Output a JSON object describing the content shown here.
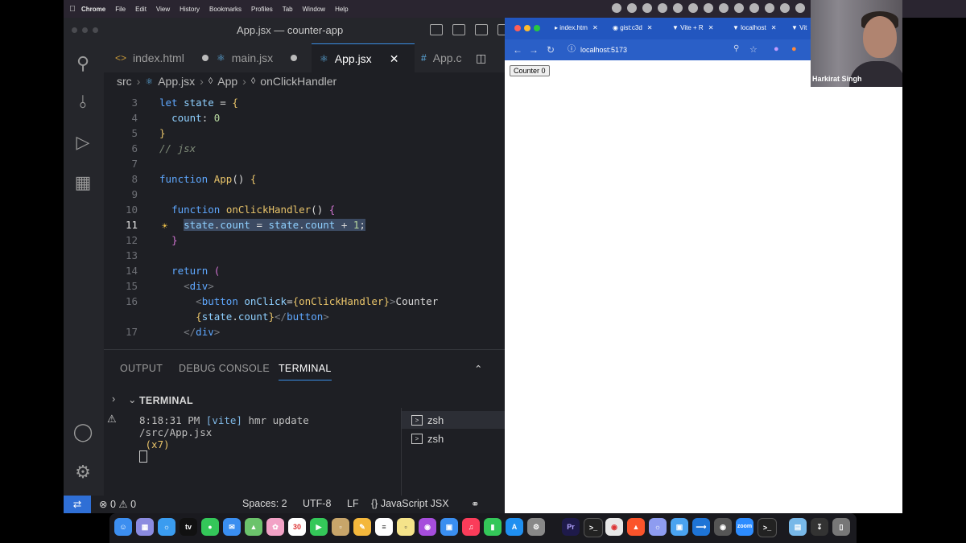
{
  "menubar": {
    "app": "Chrome",
    "items": [
      "File",
      "Edit",
      "View",
      "History",
      "Bookmarks",
      "Profiles",
      "Tab",
      "Window",
      "Help"
    ]
  },
  "vscode": {
    "window_title": "App.jsx — counter-app",
    "tabs": [
      {
        "label": "index.html",
        "modified": true
      },
      {
        "label": "main.jsx",
        "modified": true
      },
      {
        "label": "App.jsx",
        "active": true
      },
      {
        "label": "App.c"
      }
    ],
    "breadcrumb": [
      "src",
      "App.jsx",
      "App",
      "onClickHandler"
    ],
    "code_lines": [
      {
        "n": "3",
        "text": "let state = {"
      },
      {
        "n": "4",
        "text": "  count: 0"
      },
      {
        "n": "5",
        "text": "}"
      },
      {
        "n": "6",
        "text": "// jsx"
      },
      {
        "n": "7",
        "text": ""
      },
      {
        "n": "8",
        "text": "function App() {"
      },
      {
        "n": "9",
        "text": ""
      },
      {
        "n": "10",
        "text": "  function onClickHandler() {"
      },
      {
        "n": "11",
        "text": "    state.count = state.count + 1;"
      },
      {
        "n": "12",
        "text": "  }"
      },
      {
        "n": "13",
        "text": ""
      },
      {
        "n": "14",
        "text": "  return ("
      },
      {
        "n": "15",
        "text": "    <div>"
      },
      {
        "n": "16",
        "text": "      <button onClick={onClickHandler}>Counter"
      },
      {
        "n": "",
        "text": "      {state.count}</button>"
      },
      {
        "n": "17",
        "text": "    </div>"
      }
    ],
    "panel": {
      "tabs": [
        "OUTPUT",
        "DEBUG CONSOLE",
        "TERMINAL"
      ],
      "active_tab": "TERMINAL",
      "terminal_header": "TERMINAL",
      "terminal_time": "8:18:31 PM",
      "terminal_vite": "[vite]",
      "terminal_msg": "hmr update /src/App.jsx",
      "terminal_count": "(x7)",
      "shells": [
        "zsh",
        "zsh"
      ]
    },
    "status": {
      "errors": "0",
      "warnings": "0",
      "spaces": "Spaces: 2",
      "encoding": "UTF-8",
      "eol": "LF",
      "language": "JavaScript JSX"
    }
  },
  "chrome": {
    "tabs": [
      "index.htm",
      "gist:c3d",
      "Vite + R",
      "localhost",
      "Vit"
    ],
    "url": "localhost:5173",
    "page_button": "Counter 0"
  },
  "webcam": {
    "name": "Harkirat Singh"
  },
  "dock": {
    "calendar_day": "30",
    "apps": [
      "Finder",
      "Launchpad",
      "Safari",
      "Apple TV",
      "Messages",
      "Mail",
      "Maps",
      "Photos",
      "Calendar",
      "FaceTime",
      "Notes",
      "Reminders",
      "Freeform",
      "Podcasts",
      "Keynote",
      "Music",
      "Numbers",
      "App Store",
      "System Settings",
      "Premiere Pro",
      "Terminal",
      "Chrome",
      "Brave",
      "Arc",
      "Preview",
      "VS Code",
      "Screenshot",
      "Zoom",
      "Terminal 2",
      "Folder",
      "Downloads",
      "Trash"
    ]
  }
}
